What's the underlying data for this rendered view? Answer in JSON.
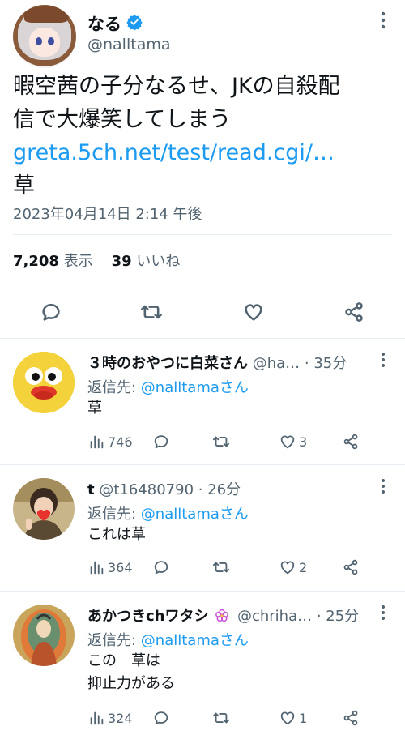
{
  "tweet": {
    "author_name": "なる",
    "author_handle": "@nalltama",
    "text_lines": [
      "暇空茜の子分なるせ、JKの自殺配",
      "信で大爆笑してしまう"
    ],
    "link": "greta.5ch.net/test/read.cgi/…",
    "text_after": "草",
    "timestamp": "2023年04月14日 2:14 午後",
    "views_count": "7,208",
    "views_label": "表示",
    "likes_count": "39",
    "likes_label": "いいね"
  },
  "replies": [
    {
      "name": "３時のおやつに白菜さん",
      "meta": "@ha… · 35分",
      "reply_to_prefix": "返信先: ",
      "reply_to_handle": "@nalltamaさん",
      "body_lines": [
        "草"
      ],
      "views": "746",
      "likes": "3"
    },
    {
      "name": "t",
      "meta": "@t16480790 · 26分",
      "reply_to_prefix": "返信先: ",
      "reply_to_handle": "@nalltamaさん",
      "body_lines": [
        "これは草"
      ],
      "views": "364",
      "likes": "2"
    },
    {
      "name": "あかつきchワタシ",
      "meta": "@chriha… · 25分",
      "reply_to_prefix": "返信先: ",
      "reply_to_handle": "@nalltamaさん",
      "body_lines": [
        "この　草は",
        "抑止力がある"
      ],
      "views": "324",
      "likes": "1"
    }
  ],
  "colors": {
    "link": "#1d9bf0",
    "secondary_text": "#536471",
    "verified": "#1d9bf0",
    "divider": "#e6ecf0",
    "emoji_flower": "#c94fd8"
  }
}
